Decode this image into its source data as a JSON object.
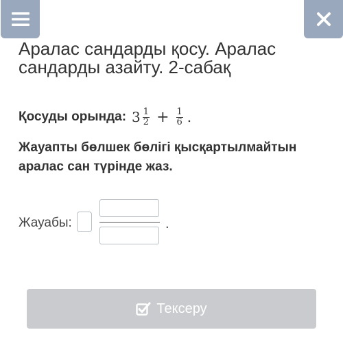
{
  "header": {
    "menu_icon": "hamburger-menu-icon",
    "close_icon": "close-x-icon"
  },
  "lesson": {
    "title": "Аралас сандарды қосу. Аралас сандарды азайту. 2-сабақ"
  },
  "task": {
    "label": "Қосуды орында:",
    "term1": {
      "whole": "3",
      "numerator": "1",
      "denominator": "2"
    },
    "operator": "+",
    "term2": {
      "numerator": "1",
      "denominator": "6"
    },
    "end": "."
  },
  "instruction": "Жауапты бөлшек бөлігі қысқартылмайтын аралас сан түрінде жаз.",
  "answer": {
    "label": "Жауабы:",
    "whole_value": "",
    "numerator_value": "",
    "denominator_value": "",
    "end": "."
  },
  "check_button": {
    "label": "Тексеру",
    "icon": "checkbox-check-icon",
    "background": "#c9cbce"
  },
  "colors": {
    "top_buttons": "#9aa8bd",
    "text": "#333333"
  }
}
